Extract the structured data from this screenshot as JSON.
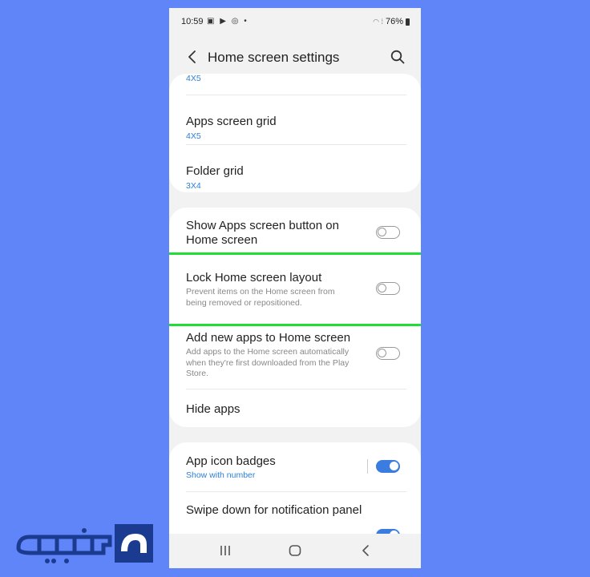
{
  "status": {
    "time": "10:59",
    "battery": "76%"
  },
  "header": {
    "title": "Home screen settings"
  },
  "top_card": {
    "partial_value": "4X5",
    "items": [
      {
        "title": "Apps screen grid",
        "value": "4X5"
      },
      {
        "title": "Folder grid",
        "value": "3X4"
      }
    ]
  },
  "middle_card": {
    "items": [
      {
        "title": "Show Apps screen button on Home screen",
        "toggle": false
      },
      {
        "title": "Lock Home screen layout",
        "desc": "Prevent items on the Home screen from being removed or repositioned.",
        "toggle": false
      },
      {
        "title": "Add new apps to Home screen",
        "desc": "Add apps to the Home screen automatically when they're first downloaded from the Play Store.",
        "toggle": false
      },
      {
        "title": "Hide apps"
      }
    ]
  },
  "bottom_card": {
    "items": [
      {
        "title": "App icon badges",
        "value": "Show with number",
        "toggle": true
      },
      {
        "title": "Swipe down for notification panel",
        "toggle": true
      }
    ]
  },
  "colors": {
    "background": "#5f85f8",
    "accent": "#3a7ce0",
    "highlight": "#22dd33",
    "logo": "#1a3b8f"
  },
  "icons": [
    "back-arrow-icon",
    "search-icon",
    "recents-icon",
    "home-icon",
    "nav-back-icon",
    "watermark-logo"
  ]
}
